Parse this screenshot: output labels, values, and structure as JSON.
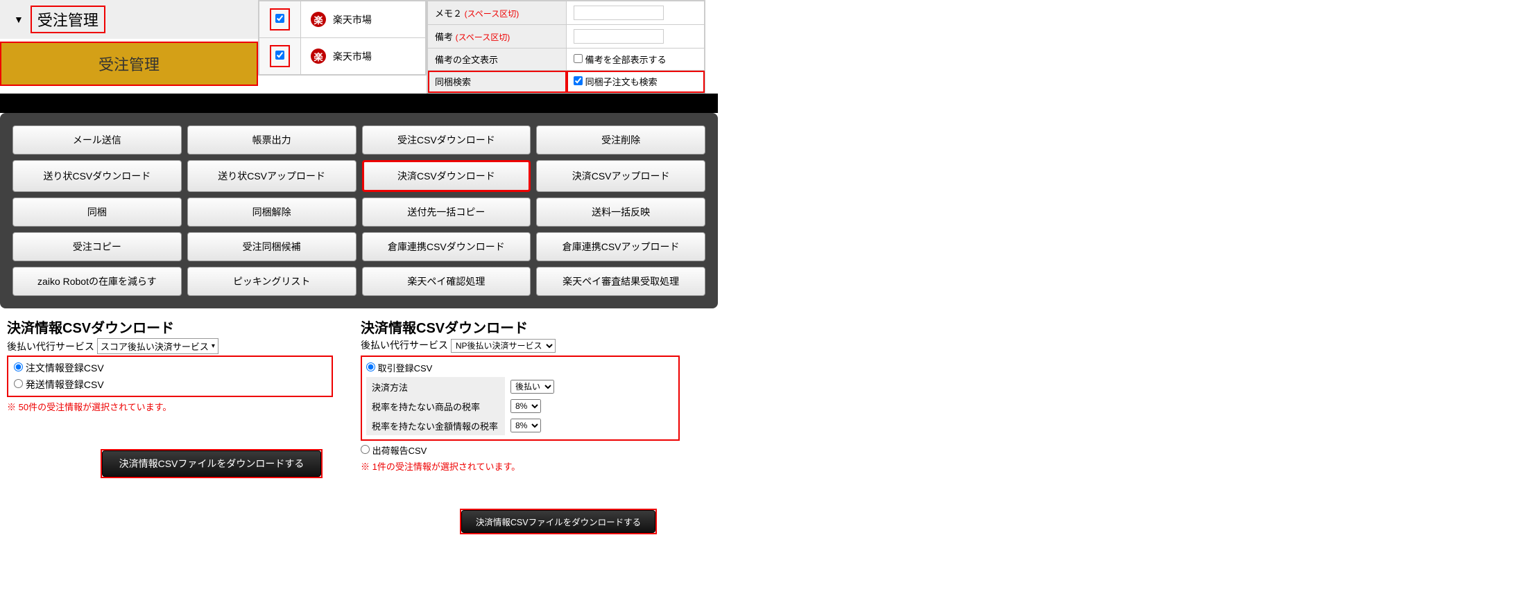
{
  "frag1": {
    "header": "受注管理",
    "tab": "受注管理"
  },
  "frag2": {
    "rows": [
      {
        "checked": true,
        "name": "楽天市場",
        "icon": "楽"
      },
      {
        "checked": true,
        "name": "楽天市場",
        "icon": "楽"
      }
    ]
  },
  "frag3": {
    "rows": [
      {
        "label": "メモ２",
        "hint": "(スペース区切)",
        "type": "text",
        "value": ""
      },
      {
        "label": "備考",
        "hint": "(スペース区切)",
        "type": "text",
        "value": ""
      },
      {
        "label": "備考の全文表示",
        "type": "check",
        "checked": false,
        "checklabel": "備考を全部表示する"
      },
      {
        "label": "同梱検索",
        "type": "check",
        "checked": true,
        "checklabel": "同梱子注文も検索",
        "hl": true
      }
    ]
  },
  "buttons": [
    "メール送信",
    "帳票出力",
    "受注CSVダウンロード",
    "受注削除",
    "送り状CSVダウンロード",
    "送り状CSVアップロード",
    "決済CSVダウンロード",
    "決済CSVアップロード",
    "同梱",
    "同梱解除",
    "送付先一括コピー",
    "送料一括反映",
    "受注コピー",
    "受注同梱候補",
    "倉庫連携CSVダウンロード",
    "倉庫連携CSVアップロード",
    "zaiko Robotの在庫を減らす",
    "ピッキングリスト",
    "楽天ペイ確認処理",
    "楽天ペイ審査結果受取処理"
  ],
  "buttons_highlight_index": 6,
  "panelA": {
    "title": "決済情報CSVダウンロード",
    "service_label": "後払い代行サービス",
    "service_value": "スコア後払い決済サービス",
    "options": [
      {
        "label": "注文情報登録CSV",
        "checked": true
      },
      {
        "label": "発送情報登録CSV",
        "checked": false
      }
    ],
    "note": "※ 50件の受注情報が選択されています。",
    "download": "決済情報CSVファイルをダウンロードする"
  },
  "panelB": {
    "title": "決済情報CSVダウンロード",
    "service_label": "後払い代行サービス",
    "service_value": "NP後払い決済サービス",
    "top_radio": {
      "label": "取引登録CSV",
      "checked": true
    },
    "table": [
      {
        "label": "決済方法",
        "value": "後払い"
      },
      {
        "label": "税率を持たない商品の税率",
        "value": "8%"
      },
      {
        "label": "税率を持たない金額情報の税率",
        "value": "8%"
      }
    ],
    "out_radio": {
      "label": "出荷報告CSV",
      "checked": false
    },
    "note": "※ 1件の受注情報が選択されています。",
    "download": "決済情報CSVファイルをダウンロードする"
  }
}
